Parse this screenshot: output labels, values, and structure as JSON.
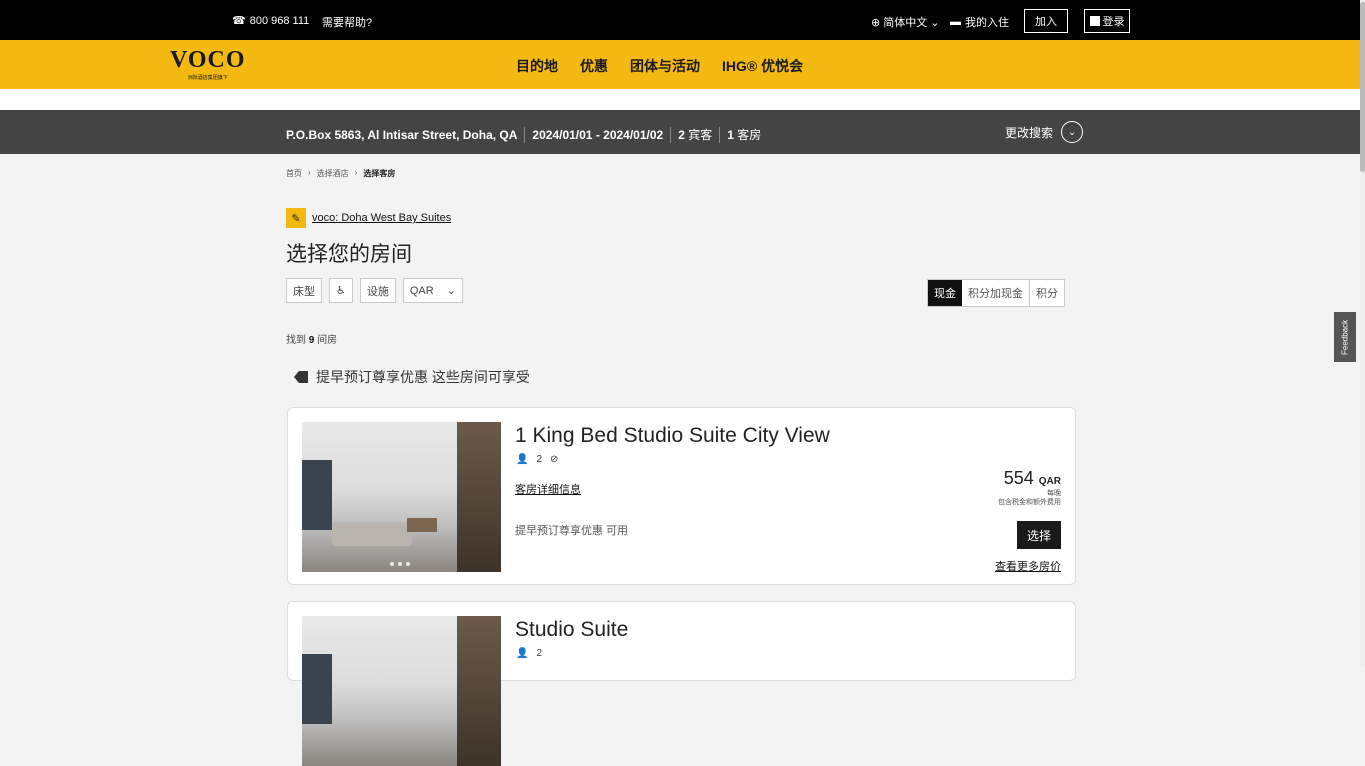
{
  "topbar": {
    "phone": "800 968 111",
    "help": "需要帮助?",
    "language": "简体中文",
    "my_stay": "我的入住",
    "join": "加入",
    "login": "登录"
  },
  "header": {
    "logo": "VOCO",
    "logo_sub": "洲际酒店集团旗下",
    "nav": [
      "目的地",
      "优惠",
      "团体与活动",
      "IHG® 优悦会"
    ],
    "brand_color": "#f4b911"
  },
  "search": {
    "location": "P.O.Box 5863, Al Intisar Street, Doha, QA",
    "dates": "2024/01/01 - 2024/01/02",
    "guests_num": "2",
    "guests_label": "宾客",
    "rooms_num": "1",
    "rooms_label": "客房",
    "change": "更改搜索"
  },
  "breadcrumb": [
    "首页",
    "选择酒店",
    "选择客房"
  ],
  "hotel": {
    "name": "voco: Doha West Bay Suites"
  },
  "page_title": "选择您的房间",
  "filters": {
    "bed_type": "床型",
    "amenities": "设施",
    "currency": "QAR"
  },
  "pay_options": [
    "现金",
    "积分加现金",
    "积分"
  ],
  "found": {
    "prefix": "找到",
    "count": "9",
    "suffix": "间房"
  },
  "promo": "提早预订尊享优惠 这些房间可享受",
  "rooms": [
    {
      "title": "1 King Bed Studio Suite City View",
      "guests": "2",
      "details_link": "客房详细信息",
      "availability": "提早预订尊享优惠 可用",
      "price": "554",
      "currency": "QAR",
      "per_night": "每晚",
      "tax_note": "包含税金和额外费用",
      "select": "选择",
      "more_rates": "查看更多房价"
    },
    {
      "title": "Studio Suite",
      "guests": "2"
    }
  ],
  "feedback": "Feedback"
}
